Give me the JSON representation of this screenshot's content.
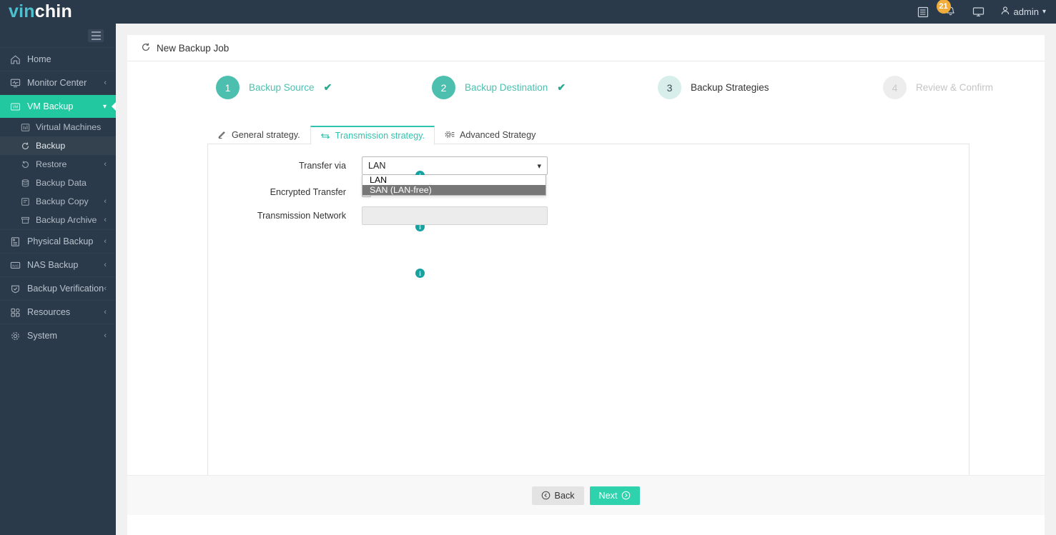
{
  "topbar": {
    "logo_first": "vin",
    "logo_second": "chin",
    "notes_icon": "list-icon",
    "bell_icon": "bell-icon",
    "bell_badge": "21",
    "monitor_icon": "monitor-icon",
    "user_icon": "user-icon",
    "user_name": "admin",
    "user_chevron": "chevron-down-icon"
  },
  "sidebar": {
    "hamburger": "hamburger-icon",
    "items": [
      {
        "label": "Home",
        "icon": "home-icon",
        "state": "normal",
        "chevron": ""
      },
      {
        "label": "Monitor Center",
        "icon": "monitor-center-icon",
        "state": "normal",
        "chevron": "‹"
      },
      {
        "label": "VM Backup",
        "icon": "vm-icon",
        "state": "active",
        "chevron": "∨"
      }
    ],
    "sub_items": [
      {
        "label": "Virtual Machines",
        "icon": "grid-icon",
        "state": "normal",
        "chevron": ""
      },
      {
        "label": "Backup",
        "icon": "refresh-icon",
        "state": "selected",
        "chevron": ""
      },
      {
        "label": "Restore",
        "icon": "restore-icon",
        "state": "normal",
        "chevron": "‹"
      },
      {
        "label": "Backup Data",
        "icon": "database-icon",
        "state": "normal",
        "chevron": ""
      },
      {
        "label": "Backup Copy",
        "icon": "copy-icon",
        "state": "normal",
        "chevron": "‹"
      },
      {
        "label": "Backup Archive",
        "icon": "archive-icon",
        "state": "normal",
        "chevron": "‹"
      }
    ],
    "items_lower": [
      {
        "label": "Physical Backup",
        "icon": "server-icon",
        "state": "normal",
        "chevron": "‹"
      },
      {
        "label": "NAS Backup",
        "icon": "nas-icon",
        "state": "normal",
        "chevron": "‹"
      },
      {
        "label": "Backup Verification",
        "icon": "shield-check-icon",
        "state": "normal",
        "chevron": "‹"
      },
      {
        "label": "Resources",
        "icon": "resources-icon",
        "state": "normal",
        "chevron": "‹"
      },
      {
        "label": "System",
        "icon": "gear-icon",
        "state": "normal",
        "chevron": "‹"
      }
    ]
  },
  "page": {
    "title": "New Backup Job",
    "title_icon": "refresh-icon"
  },
  "steps": [
    {
      "number": "1",
      "label": "Backup Source",
      "state": "done",
      "tick": "✔"
    },
    {
      "number": "2",
      "label": "Backup Destination",
      "state": "done",
      "tick": "✔"
    },
    {
      "number": "3",
      "label": "Backup Strategies",
      "state": "current",
      "tick": ""
    },
    {
      "number": "4",
      "label": "Review & Confirm",
      "state": "disabled",
      "tick": ""
    }
  ],
  "tabs": [
    {
      "label": "General strategy.",
      "icon": "pencil-icon",
      "active": false
    },
    {
      "label": "Transmission strategy.",
      "icon": "transfer-arrows-icon",
      "active": true
    },
    {
      "label": "Advanced Strategy",
      "icon": "gear-sliders-icon",
      "active": false
    }
  ],
  "form": {
    "transfer_via": {
      "label": "Transfer via",
      "value": "LAN",
      "chevron": "∨",
      "info_icon": "info-icon",
      "info_char": "i",
      "open": true,
      "options": [
        {
          "label": "LAN",
          "selected": false
        },
        {
          "label": "SAN (LAN-free)",
          "selected": true
        }
      ]
    },
    "encrypted_transfer": {
      "label": "Encrypted Transfer",
      "value": "",
      "info_icon": "info-icon",
      "info_char": "i"
    },
    "transmission_network": {
      "label": "Transmission Network",
      "value": "",
      "placeholder": "",
      "disabled": true,
      "info_icon": "info-icon",
      "info_char": "i"
    }
  },
  "footer": {
    "back_label": "Back",
    "back_icon": "arrow-left-circle-icon",
    "next_label": "Next",
    "next_icon": "arrow-right-circle-icon"
  },
  "colors": {
    "brand_teal": "#2ec4b0",
    "sidebar_bg": "#2b3a4a",
    "active_nav": "#22c8a0",
    "badge_amber": "#f0ad3c",
    "info_teal": "#17a1a1",
    "next_btn": "#2ed3ad"
  }
}
